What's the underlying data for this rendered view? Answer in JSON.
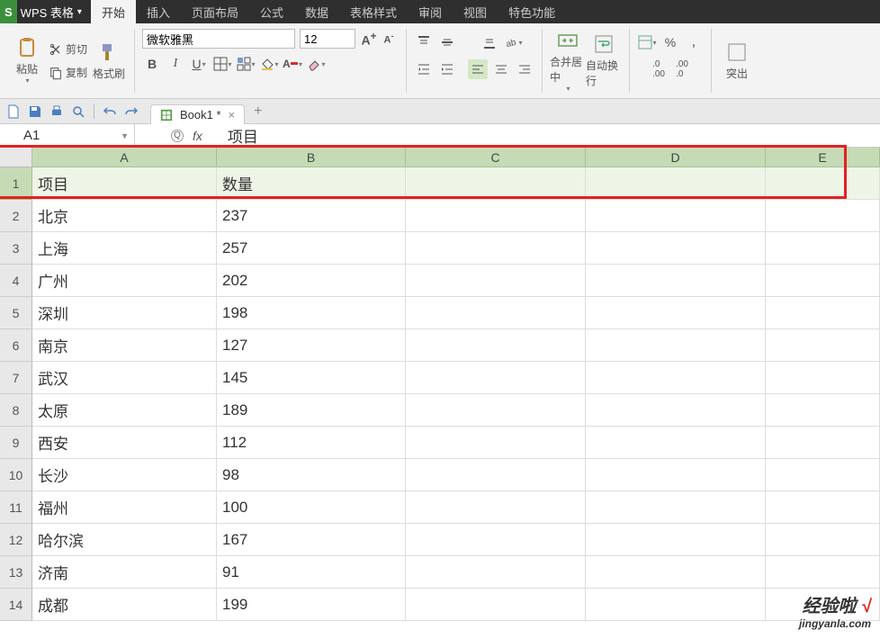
{
  "app": {
    "logo": "S",
    "name": "WPS 表格",
    "dropdown": "▾"
  },
  "menu_tabs": [
    "开始",
    "插入",
    "页面布局",
    "公式",
    "数据",
    "表格样式",
    "审阅",
    "视图",
    "特色功能"
  ],
  "active_tab_index": 0,
  "ribbon": {
    "paste": "粘贴",
    "cut": "剪切",
    "copy": "复制",
    "format_painter": "格式刷",
    "font_name": "微软雅黑",
    "font_size": "12",
    "merge_center": "合并居中",
    "wrap_text": "自动换行",
    "percent": "%",
    "overflow": "突出"
  },
  "quick": {},
  "doc_tab": {
    "name": "Book1 *",
    "close": "×",
    "add": "+"
  },
  "formula_bar": {
    "name_box": "A1",
    "fx": "fx",
    "value": "项目"
  },
  "columns": [
    "A",
    "B",
    "C",
    "D",
    "E"
  ],
  "col_widths": [
    "col-A",
    "col-B",
    "col-C",
    "col-D",
    "col-E"
  ],
  "rows": [
    {
      "n": 1,
      "cells": [
        "项目",
        "数量",
        "",
        "",
        ""
      ]
    },
    {
      "n": 2,
      "cells": [
        "北京",
        "237",
        "",
        "",
        ""
      ]
    },
    {
      "n": 3,
      "cells": [
        "上海",
        "257",
        "",
        "",
        ""
      ]
    },
    {
      "n": 4,
      "cells": [
        "广州",
        "202",
        "",
        "",
        ""
      ]
    },
    {
      "n": 5,
      "cells": [
        "深圳",
        "198",
        "",
        "",
        ""
      ]
    },
    {
      "n": 6,
      "cells": [
        "南京",
        "127",
        "",
        "",
        ""
      ]
    },
    {
      "n": 7,
      "cells": [
        "武汉",
        "145",
        "",
        "",
        ""
      ]
    },
    {
      "n": 8,
      "cells": [
        "太原",
        "189",
        "",
        "",
        ""
      ]
    },
    {
      "n": 9,
      "cells": [
        "西安",
        "112",
        "",
        "",
        ""
      ]
    },
    {
      "n": 10,
      "cells": [
        "长沙",
        "98",
        "",
        "",
        ""
      ]
    },
    {
      "n": 11,
      "cells": [
        "福州",
        "100",
        "",
        "",
        ""
      ]
    },
    {
      "n": 12,
      "cells": [
        "哈尔滨",
        "167",
        "",
        "",
        ""
      ]
    },
    {
      "n": 13,
      "cells": [
        "济南",
        "91",
        "",
        "",
        ""
      ]
    },
    {
      "n": 14,
      "cells": [
        "成都",
        "199",
        "",
        "",
        ""
      ]
    }
  ],
  "watermark": {
    "line1": "经验啦",
    "check": "√",
    "line2": "jingyanla.com"
  }
}
